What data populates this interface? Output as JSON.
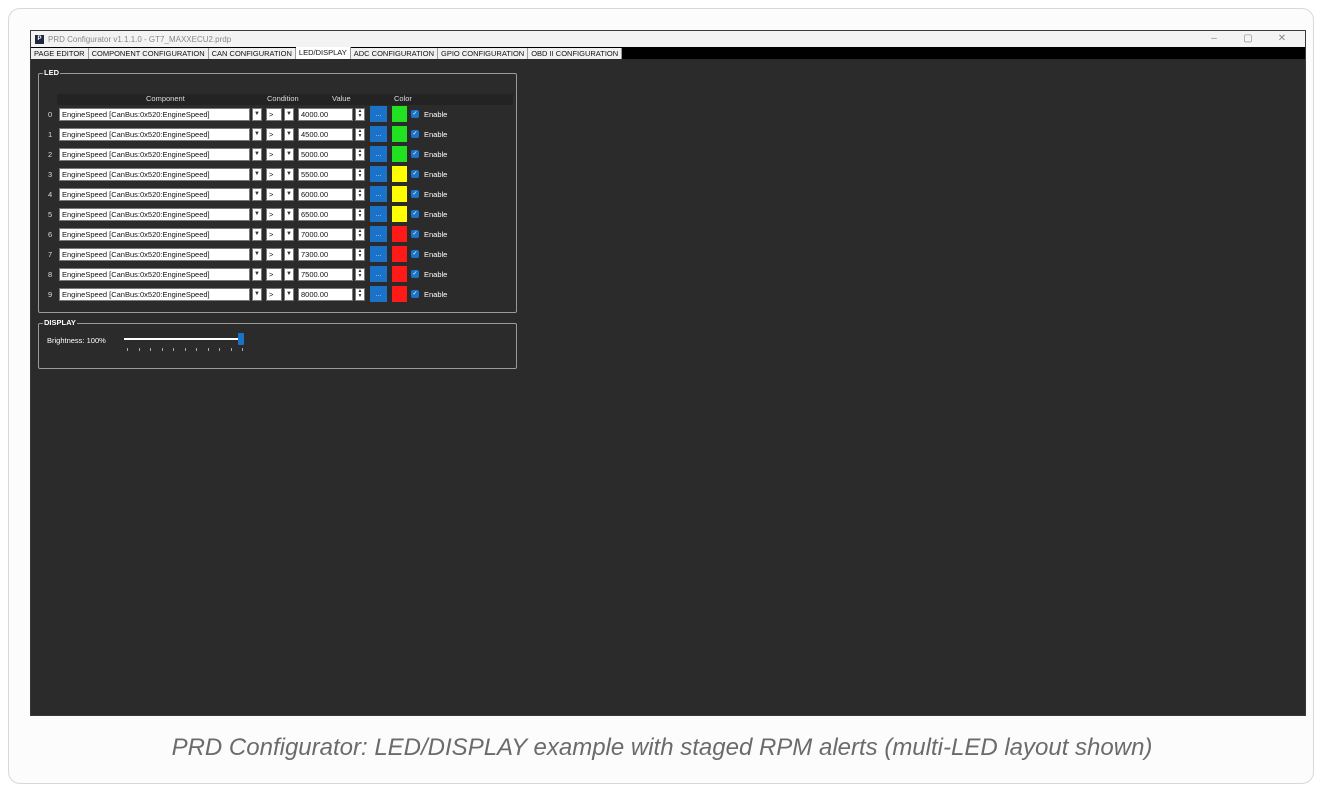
{
  "window": {
    "title": "PRD Configurator v1.1.1.0 - GT7_MAXXECU2.prdp"
  },
  "tabs": [
    "PAGE EDITOR",
    "COMPONENT CONFIGURATION",
    "CAN CONFIGURATION",
    "LED/DISPLAY",
    "ADC CONFIGURATION",
    "GPIO CONFIGURATION",
    "OBD II CONFIGURATION"
  ],
  "active_tab": "LED/DISPLAY",
  "led": {
    "group_title": "LED",
    "headers": {
      "component": "Component",
      "condition": "Condition",
      "value": "Value",
      "color": "Color"
    },
    "pick_label": "...",
    "enable_label": "Enable",
    "rows": [
      {
        "index": "0",
        "component": "EngineSpeed [CanBus:0x520:EngineSpeed]",
        "condition": ">",
        "value": "4000.00",
        "color": "#22e022",
        "enabled": true
      },
      {
        "index": "1",
        "component": "EngineSpeed [CanBus:0x520:EngineSpeed]",
        "condition": ">",
        "value": "4500.00",
        "color": "#22e022",
        "enabled": true
      },
      {
        "index": "2",
        "component": "EngineSpeed [CanBus:0x520:EngineSpeed]",
        "condition": ">",
        "value": "5000.00",
        "color": "#22e022",
        "enabled": true
      },
      {
        "index": "3",
        "component": "EngineSpeed [CanBus:0x520:EngineSpeed]",
        "condition": ">",
        "value": "5500.00",
        "color": "#ffff00",
        "enabled": true
      },
      {
        "index": "4",
        "component": "EngineSpeed [CanBus:0x520:EngineSpeed]",
        "condition": ">",
        "value": "6000.00",
        "color": "#ffff00",
        "enabled": true
      },
      {
        "index": "5",
        "component": "EngineSpeed [CanBus:0x520:EngineSpeed]",
        "condition": ">",
        "value": "6500.00",
        "color": "#ffff00",
        "enabled": true
      },
      {
        "index": "6",
        "component": "EngineSpeed [CanBus:0x520:EngineSpeed]",
        "condition": ">",
        "value": "7000.00",
        "color": "#ff1a1a",
        "enabled": true
      },
      {
        "index": "7",
        "component": "EngineSpeed [CanBus:0x520:EngineSpeed]",
        "condition": ">",
        "value": "7300.00",
        "color": "#ff1a1a",
        "enabled": true
      },
      {
        "index": "8",
        "component": "EngineSpeed [CanBus:0x520:EngineSpeed]",
        "condition": ">",
        "value": "7500.00",
        "color": "#ff1a1a",
        "enabled": true
      },
      {
        "index": "9",
        "component": "EngineSpeed [CanBus:0x520:EngineSpeed]",
        "condition": ">",
        "value": "8000.00",
        "color": "#ff1a1a",
        "enabled": true
      }
    ]
  },
  "display": {
    "group_title": "DISPLAY",
    "brightness_label": "Brightness: 100%",
    "brightness_value": 1.0
  },
  "caption": "PRD Configurator: LED/DISPLAY example with staged RPM alerts (multi-LED layout shown)",
  "colors": {
    "accent": "#1a73c8",
    "background": "#2b2b2b"
  }
}
